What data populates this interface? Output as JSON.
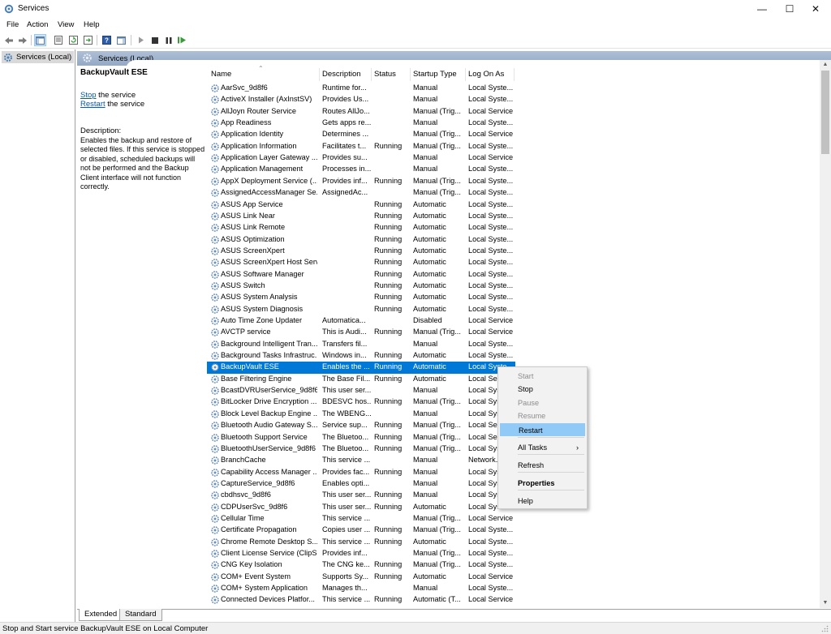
{
  "window": {
    "title": "Services"
  },
  "menu": [
    "File",
    "Action",
    "View",
    "Help"
  ],
  "tree": {
    "root_label": "Services (Local)"
  },
  "header": {
    "label": "Services (Local)"
  },
  "details": {
    "service_name": "BackupVault ESE",
    "stop_link": "Stop",
    "stop_suffix": " the service",
    "restart_link": "Restart",
    "restart_suffix": " the service",
    "description_label": "Description:",
    "description_text": "Enables the backup and restore of selected files. If this service is stopped or disabled, scheduled backups will not be performed and the Backup Client interface will not function correctly."
  },
  "columns": [
    "Name",
    "Description",
    "Status",
    "Startup Type",
    "Log On As"
  ],
  "services": [
    [
      "AarSvc_9d8f6",
      "Runtime for...",
      "",
      "Manual",
      "Local Syste..."
    ],
    [
      "ActiveX Installer (AxInstSV)",
      "Provides Us...",
      "",
      "Manual",
      "Local Syste..."
    ],
    [
      "AllJoyn Router Service",
      "Routes AllJo...",
      "",
      "Manual (Trig...",
      "Local Service"
    ],
    [
      "App Readiness",
      "Gets apps re...",
      "",
      "Manual",
      "Local Syste..."
    ],
    [
      "Application Identity",
      "Determines ...",
      "",
      "Manual (Trig...",
      "Local Service"
    ],
    [
      "Application Information",
      "Facilitates t...",
      "Running",
      "Manual (Trig...",
      "Local Syste..."
    ],
    [
      "Application Layer Gateway ...",
      "Provides su...",
      "",
      "Manual",
      "Local Service"
    ],
    [
      "Application Management",
      "Processes in...",
      "",
      "Manual",
      "Local Syste..."
    ],
    [
      "AppX Deployment Service (...",
      "Provides inf...",
      "Running",
      "Manual (Trig...",
      "Local Syste..."
    ],
    [
      "AssignedAccessManager Se...",
      "AssignedAc...",
      "",
      "Manual (Trig...",
      "Local Syste..."
    ],
    [
      "ASUS App Service",
      "",
      "Running",
      "Automatic",
      "Local Syste..."
    ],
    [
      "ASUS Link Near",
      "",
      "Running",
      "Automatic",
      "Local Syste..."
    ],
    [
      "ASUS Link Remote",
      "",
      "Running",
      "Automatic",
      "Local Syste..."
    ],
    [
      "ASUS Optimization",
      "",
      "Running",
      "Automatic",
      "Local Syste..."
    ],
    [
      "ASUS ScreenXpert",
      "",
      "Running",
      "Automatic",
      "Local Syste..."
    ],
    [
      "ASUS ScreenXpert Host Serv...",
      "",
      "Running",
      "Automatic",
      "Local Syste..."
    ],
    [
      "ASUS Software Manager",
      "",
      "Running",
      "Automatic",
      "Local Syste..."
    ],
    [
      "ASUS Switch",
      "",
      "Running",
      "Automatic",
      "Local Syste..."
    ],
    [
      "ASUS System Analysis",
      "",
      "Running",
      "Automatic",
      "Local Syste..."
    ],
    [
      "ASUS System Diagnosis",
      "",
      "Running",
      "Automatic",
      "Local Syste..."
    ],
    [
      "Auto Time Zone Updater",
      "Automatica...",
      "",
      "Disabled",
      "Local Service"
    ],
    [
      "AVCTP service",
      "This is Audi...",
      "Running",
      "Manual (Trig...",
      "Local Service"
    ],
    [
      "Background Intelligent Tran...",
      "Transfers fil...",
      "",
      "Manual",
      "Local Syste..."
    ],
    [
      "Background Tasks Infrastruc...",
      "Windows in...",
      "Running",
      "Automatic",
      "Local Syste..."
    ],
    [
      "BackupVault ESE",
      "Enables the ...",
      "Running",
      "Automatic",
      "Local Syste..."
    ],
    [
      "Base Filtering Engine",
      "The Base Fil...",
      "Running",
      "Automatic",
      "Local Serv..."
    ],
    [
      "BcastDVRUserService_9d8f6",
      "This user ser...",
      "",
      "Manual",
      "Local Syst..."
    ],
    [
      "BitLocker Drive Encryption ...",
      "BDESVC hos...",
      "Running",
      "Manual (Trig...",
      "Local Syst..."
    ],
    [
      "Block Level Backup Engine ...",
      "The WBENG...",
      "",
      "Manual",
      "Local Syst..."
    ],
    [
      "Bluetooth Audio Gateway S...",
      "Service sup...",
      "Running",
      "Manual (Trig...",
      "Local Serv..."
    ],
    [
      "Bluetooth Support Service",
      "The Bluetoo...",
      "Running",
      "Manual (Trig...",
      "Local Serv..."
    ],
    [
      "BluetoothUserService_9d8f6",
      "The Bluetoo...",
      "Running",
      "Manual (Trig...",
      "Local Syst..."
    ],
    [
      "BranchCache",
      "This service ...",
      "",
      "Manual",
      "Network..."
    ],
    [
      "Capability Access Manager ...",
      "Provides fac...",
      "Running",
      "Manual",
      "Local Syst..."
    ],
    [
      "CaptureService_9d8f6",
      "Enables opti...",
      "",
      "Manual",
      "Local Syst..."
    ],
    [
      "cbdhsvc_9d8f6",
      "This user ser...",
      "Running",
      "Manual",
      "Local Syst..."
    ],
    [
      "CDPUserSvc_9d8f6",
      "This user ser...",
      "Running",
      "Automatic",
      "Local Syst..."
    ],
    [
      "Cellular Time",
      "This service ...",
      "",
      "Manual (Trig...",
      "Local Service"
    ],
    [
      "Certificate Propagation",
      "Copies user ...",
      "Running",
      "Manual (Trig...",
      "Local Syste..."
    ],
    [
      "Chrome Remote Desktop S...",
      "This service ...",
      "Running",
      "Automatic",
      "Local Syste..."
    ],
    [
      "Client License Service (ClipS...",
      "Provides inf...",
      "",
      "Manual (Trig...",
      "Local Syste..."
    ],
    [
      "CNG Key Isolation",
      "The CNG ke...",
      "Running",
      "Manual (Trig...",
      "Local Syste..."
    ],
    [
      "COM+ Event System",
      "Supports Sy...",
      "Running",
      "Automatic",
      "Local Service"
    ],
    [
      "COM+ System Application",
      "Manages th...",
      "",
      "Manual",
      "Local Syste..."
    ],
    [
      "Connected Devices Platfor...",
      "This service ...",
      "Running",
      "Automatic (T...",
      "Local Service"
    ]
  ],
  "selected_service": "BackupVault ESE",
  "context_menu": {
    "items": [
      {
        "label": "Start",
        "state": "disabled"
      },
      {
        "label": "Stop",
        "state": "enabled"
      },
      {
        "label": "Pause",
        "state": "disabled"
      },
      {
        "label": "Resume",
        "state": "disabled"
      },
      {
        "label": "Restart",
        "state": "highlighted"
      },
      {
        "label": "All Tasks",
        "state": "submenu"
      },
      {
        "label": "Refresh",
        "state": "enabled"
      },
      {
        "label": "Properties",
        "state": "default"
      },
      {
        "label": "Help",
        "state": "enabled"
      }
    ]
  },
  "tabs": [
    "Extended",
    "Standard"
  ],
  "status_bar": "Stop and Start service BackupVault ESE on Local Computer",
  "colors": {
    "selection": "#0078d7",
    "menu_highlight": "#91c9f7",
    "header": "#a3b6cf",
    "link": "#0b5aa6"
  }
}
